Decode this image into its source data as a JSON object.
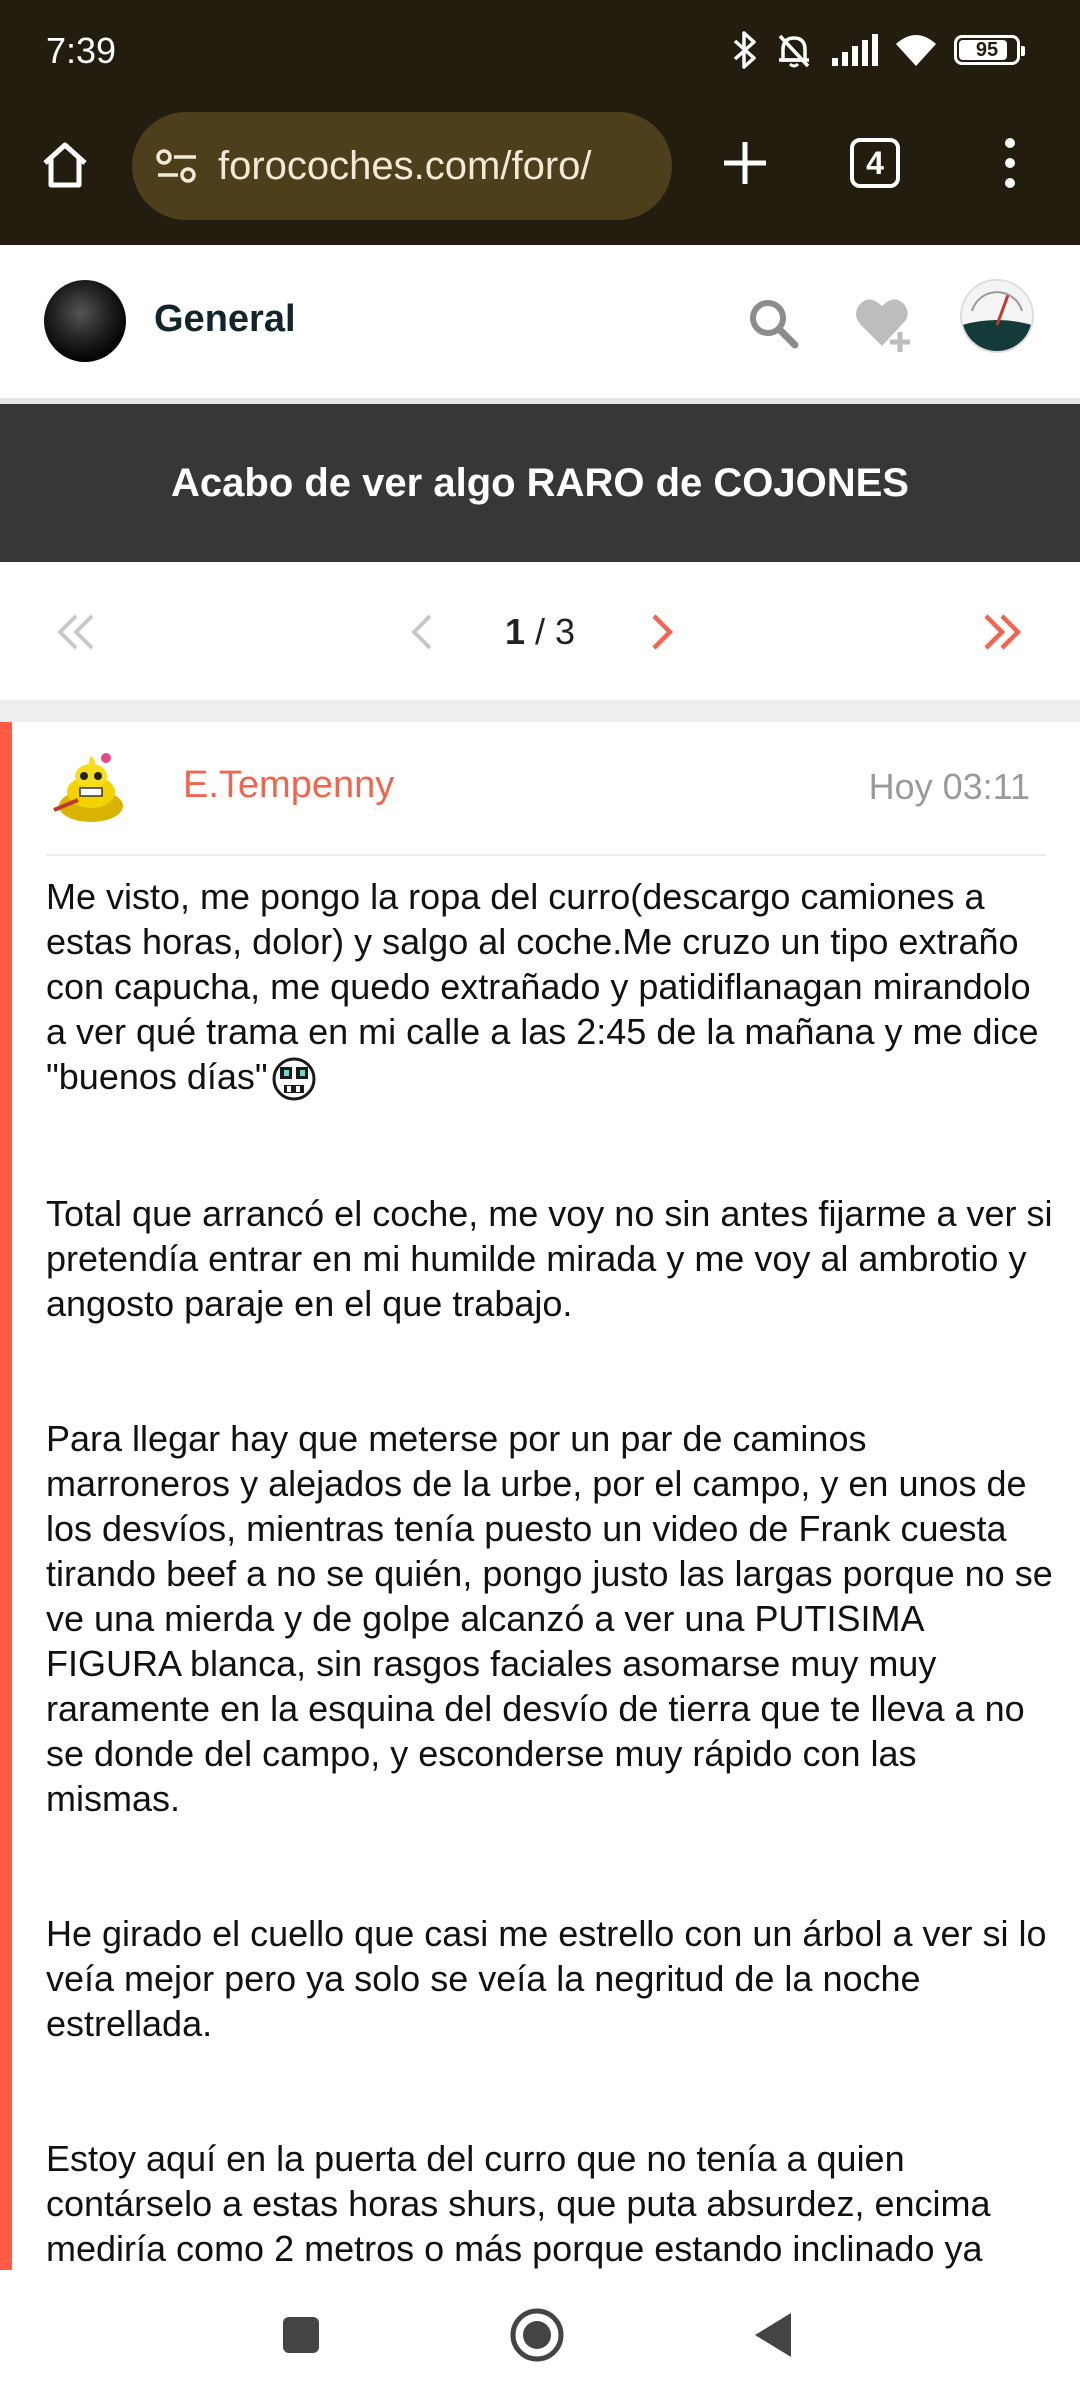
{
  "status_bar": {
    "time": "7:39",
    "battery": "95",
    "icons": [
      "bluetooth-icon",
      "bell-off-icon",
      "signal-icon",
      "wifi-icon",
      "battery-icon"
    ]
  },
  "browser": {
    "url": "forocoches.com/foro/",
    "tab_count": "4"
  },
  "site": {
    "section": "General"
  },
  "thread": {
    "title": "Acabo de ver algo RARO de COJONES"
  },
  "pagination": {
    "current": "1",
    "separator": " / ",
    "total": "3"
  },
  "post": {
    "author": "E.Tempenny",
    "time": "Hoy 03:11",
    "paragraphs": [
      "Me visto, me pongo la ropa del curro(descargo camiones a estas horas, dolor) y salgo al coche.Me cruzo un tipo extraño con capucha, me quedo extrañado y patidiflanagan mirandolo a ver qué trama en mi calle a las 2:45 de la mañana y me dice \"buenos días\"",
      "Total que arrancó el coche, me voy no sin antes fijarme a ver si pretendía entrar en mi humilde mirada y me voy al ambrotio y angosto paraje en el que trabajo.",
      "Para llegar hay que meterse por un par de caminos marroneros y alejados de la urbe, por el campo, y en unos de los desvíos, mientras tenía puesto un video de Frank cuesta tirando beef a no se quién, pongo justo las largas porque no se ve una mierda y de golpe alcanzó a ver una PUTISIMA FIGURA blanca, sin rasgos faciales asomarse muy muy raramente en la esquina del desvío de tierra que te lleva a no se donde del campo, y esconderse muy rápido con las mismas.",
      "He girado el cuello que casi me estrello con un árbol a ver si lo veía mejor pero ya solo se veía la negritud de la noche estrellada.",
      "Estoy aquí en la puerta del curro que no tenía a quien contárselo a estas horas shurs, que puta absurdez, encima mediría como 2 metros o más porque estando inclinado ya"
    ]
  },
  "colors": {
    "accent": "#ff5a45",
    "author": "#f0654f",
    "title_bar": "#373737",
    "chrome": "#231d0f"
  }
}
